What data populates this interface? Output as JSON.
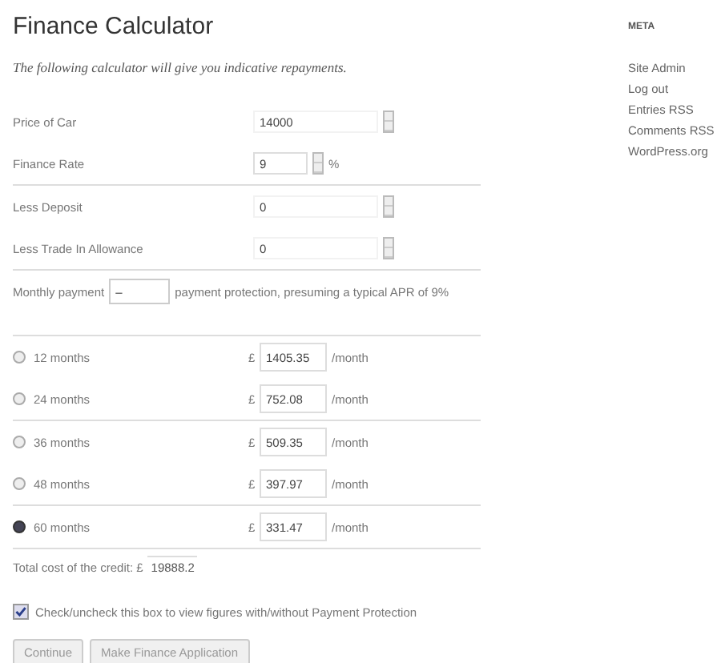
{
  "title": "Finance Calculator",
  "intro": "The following calculator will give you indicative repayments.",
  "fields": [
    {
      "label": "Price of Car",
      "value": "14000",
      "kind": "wide"
    },
    {
      "label": "Finance Rate",
      "value": "9",
      "kind": "rate",
      "suffix": "%"
    },
    {
      "label": "Less Deposit",
      "value": "0",
      "kind": "wide"
    },
    {
      "label": "Less Trade In Allowance",
      "value": "0",
      "kind": "wide"
    }
  ],
  "monthly": {
    "label": "Monthly payment",
    "value": "–",
    "note": "payment protection, presuming a typical APR of 9%"
  },
  "terms": [
    {
      "label": "12 months",
      "currency": "£",
      "value": "1405.35",
      "unit": "/month",
      "selected": false
    },
    {
      "label": "24 months",
      "currency": "£",
      "value": "752.08",
      "unit": "/month",
      "selected": false
    },
    {
      "label": "36 months",
      "currency": "£",
      "value": "509.35",
      "unit": "/month",
      "selected": false
    },
    {
      "label": "48 months",
      "currency": "£",
      "value": "397.97",
      "unit": "/month",
      "selected": false
    },
    {
      "label": "60 months",
      "currency": "£",
      "value": "331.47",
      "unit": "/month",
      "selected": true
    }
  ],
  "total": {
    "label": "Total cost of the credit: £",
    "value": "19888.2"
  },
  "protection": {
    "label": "Check/uncheck this box to view figures with/without Payment Protection",
    "checked": true
  },
  "buttons": [
    "Continue",
    "Make Finance Application"
  ],
  "sidebar": {
    "heading": "META",
    "links": [
      "Site Admin",
      "Log out",
      "Entries RSS",
      "Comments RSS",
      "WordPress.org"
    ]
  }
}
